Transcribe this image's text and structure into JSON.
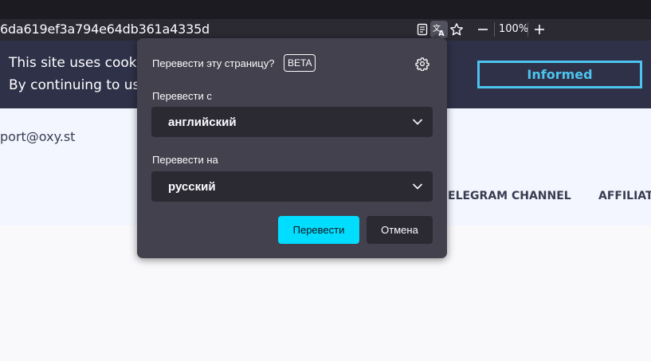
{
  "browser": {
    "url": "6da619ef3a794e64db361a4335d",
    "zoom": "100%",
    "icons": [
      "reader-view-icon",
      "translate-icon",
      "bookmark-star-icon",
      "zoom-out-icon",
      "zoom-in-icon"
    ]
  },
  "site": {
    "cookie_line1": "This site uses cookies",
    "cookie_line2": "By continuing to use",
    "cookie_button": "Informed",
    "email": "port@oxy.st",
    "nav": [
      "ELEGRAM CHANNEL",
      "AFFILIATE"
    ]
  },
  "translate_popup": {
    "title": "Перевести эту страницу?",
    "badge": "BETA",
    "from_label": "Перевести с",
    "from_value": "английский",
    "to_label": "Перевести на",
    "to_value": "русский",
    "translate_button": "Перевести",
    "cancel_button": "Отмена"
  },
  "colors": {
    "popup_bg": "#42414d",
    "primary_button": "#00ddff",
    "cookie_banner": "#2f3149",
    "accent": "#4cc4ee"
  }
}
